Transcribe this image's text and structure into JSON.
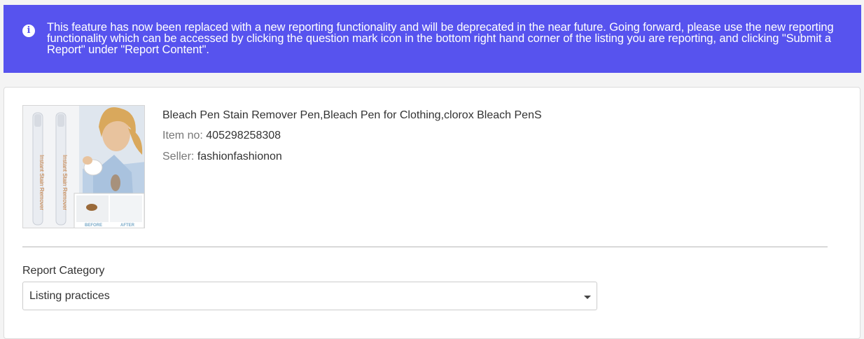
{
  "notice": {
    "icon": "info-icon",
    "background": "#5753ee",
    "text": "This feature has now been replaced with a new reporting functionality and will be deprecated in the near future. Going forward, please use the new reporting functionality which can be accessed by clicking the question mark icon in the bottom right hand corner of the listing you are reporting, and clicking \"Submit a Report\" under \"Report Content\"."
  },
  "listing": {
    "title": "Bleach Pen Stain Remover Pen,Bleach Pen for Clothing,clorox Bleach PenS",
    "item_no_label": "Item no:",
    "item_no": "405298258308",
    "seller_label": "Seller:",
    "seller": "fashionfashionon",
    "image": {
      "pen_label": "Instant Stain Remover",
      "before": "BEFORE",
      "after": "AFTER"
    }
  },
  "report": {
    "category_label": "Report Category",
    "category_value": "Listing practices"
  }
}
